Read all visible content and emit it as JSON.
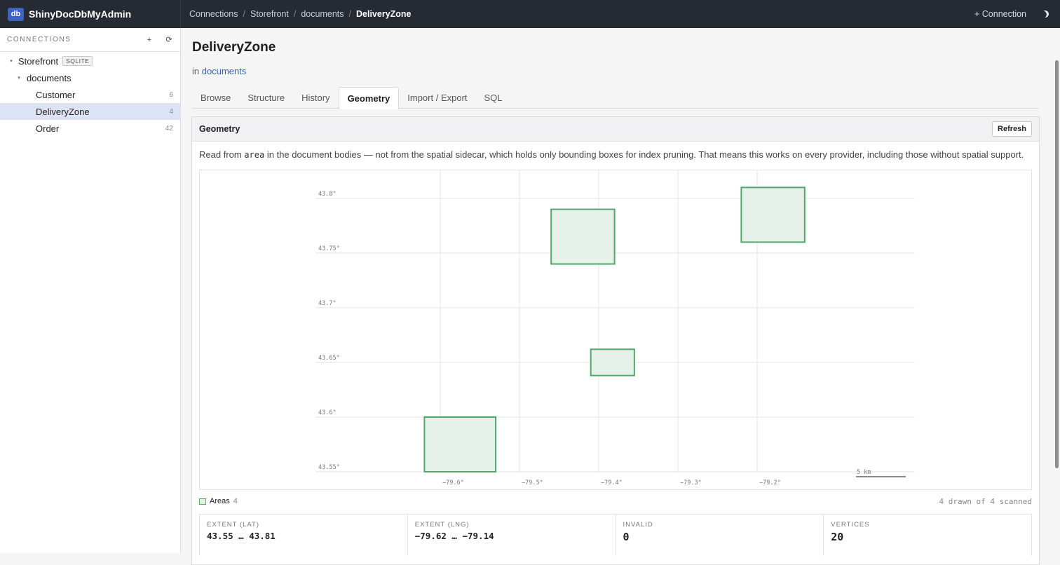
{
  "app": {
    "logo": "db",
    "title": "ShinyDocDbMyAdmin"
  },
  "breadcrumb": [
    "Connections",
    "Storefront",
    "documents",
    "DeliveryZone"
  ],
  "top_actions": {
    "connection_label": "+ Connection",
    "theme_icon": "moon-icon"
  },
  "sidebar": {
    "header": "CONNECTIONS",
    "add_icon": "+",
    "refresh_icon": "⟳",
    "connection": {
      "name": "Storefront",
      "badge": "SQLITE"
    },
    "database": {
      "name": "documents"
    },
    "collections": [
      {
        "name": "Customer",
        "count": "6"
      },
      {
        "name": "DeliveryZone",
        "count": "4",
        "selected": true
      },
      {
        "name": "Order",
        "count": "42"
      }
    ]
  },
  "page": {
    "title": "DeliveryZone",
    "in_prefix": "in",
    "in_link": "documents",
    "tabs": [
      "Browse",
      "Structure",
      "History",
      "Geometry",
      "Import / Export",
      "SQL"
    ],
    "active_tab": "Geometry"
  },
  "panel": {
    "title": "Geometry",
    "refresh_label": "Refresh",
    "note_before": "Read from",
    "note_code": "area",
    "note_after": "in the document bodies — not from the spatial sidecar, which holds only bounding boxes for index pruning. That means this works on every provider, including those without spatial support."
  },
  "chart_data": {
    "type": "map",
    "x_ticks": [
      -79.6,
      -79.5,
      -79.4,
      -79.3,
      -79.2
    ],
    "x_tick_labels": [
      "−79.6°",
      "−79.5°",
      "−79.4°",
      "−79.3°",
      "−79.2°"
    ],
    "y_ticks": [
      43.8,
      43.75,
      43.7,
      43.65,
      43.6,
      43.55
    ],
    "y_tick_labels": [
      "43.8°",
      "43.75°",
      "43.7°",
      "43.65°",
      "43.6°",
      "43.55°"
    ],
    "scale_label": "5 km",
    "colors": {
      "stroke": "#4fa86a",
      "fill": "#e6f2e9",
      "grid": "#e3e3e3"
    },
    "areas": [
      {
        "lng": [
          -79.62,
          -79.53
        ],
        "lat": [
          43.55,
          43.6
        ]
      },
      {
        "lng": [
          -79.41,
          -79.355
        ],
        "lat": [
          43.638,
          43.662
        ]
      },
      {
        "lng": [
          -79.46,
          -79.38
        ],
        "lat": [
          43.74,
          43.79
        ]
      },
      {
        "lng": [
          -79.22,
          -79.14
        ],
        "lat": [
          43.76,
          43.81
        ]
      }
    ]
  },
  "legend": {
    "label": "Areas",
    "count": "4"
  },
  "scanned": "4 drawn of 4 scanned",
  "stats": [
    {
      "key": "EXTENT (LAT)",
      "value": "43.55 … 43.81"
    },
    {
      "key": "EXTENT (LNG)",
      "value": "−79.62 … −79.14"
    },
    {
      "key": "INVALID",
      "value": "0"
    },
    {
      "key": "VERTICES",
      "value": "20"
    }
  ]
}
